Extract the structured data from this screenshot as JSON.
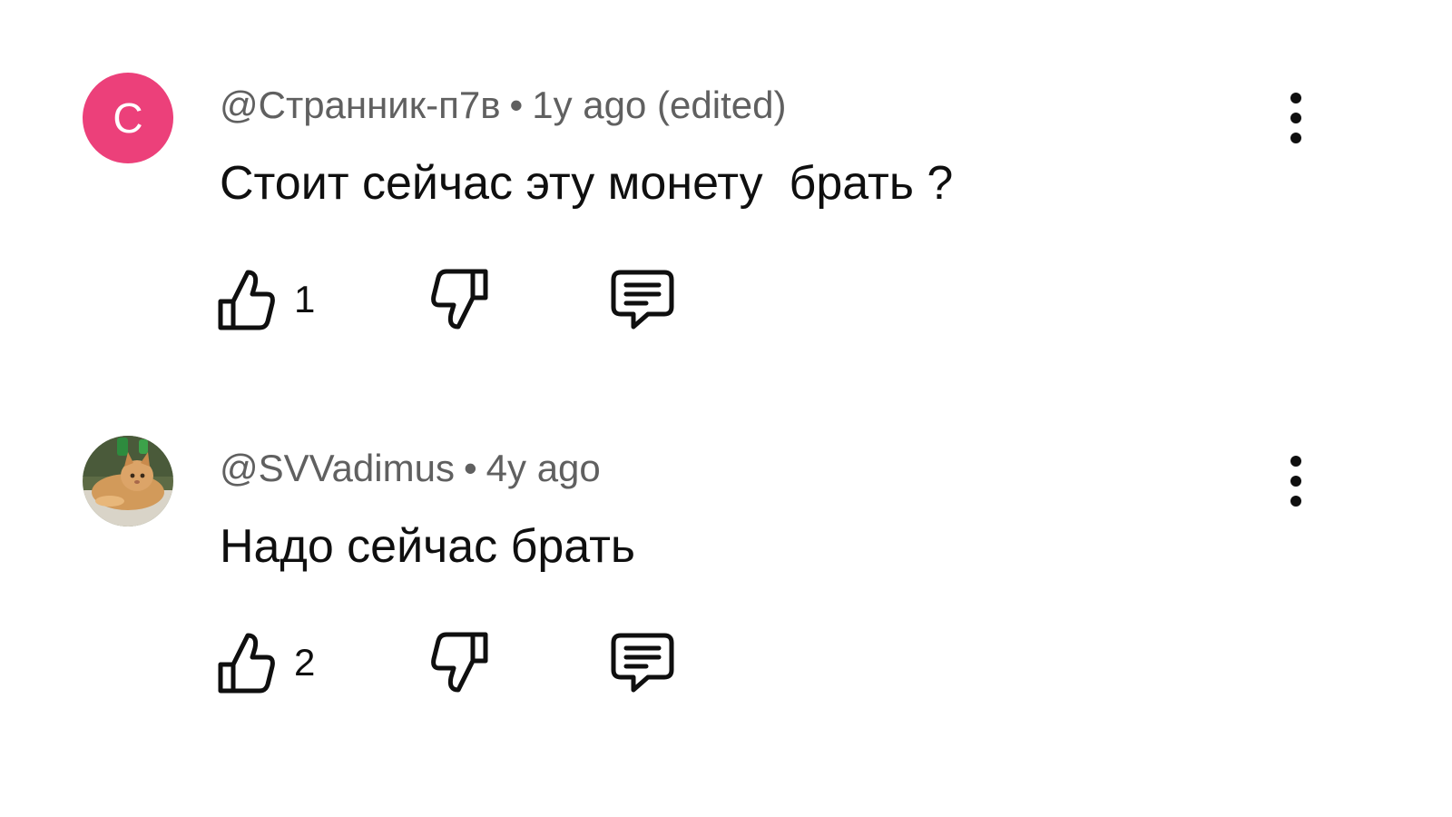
{
  "comments": [
    {
      "avatar_letter": "С",
      "avatar_color": "#ec407a",
      "author": "@Странник-п7в",
      "separator": "•",
      "time": "1y ago (edited)",
      "text": "Стоит сейчас эту монету  брать ?",
      "likes": "1"
    },
    {
      "avatar_letter": "",
      "author": "@SVVadimus",
      "separator": "•",
      "time": "4y ago",
      "text": "Надо сейчас брать",
      "likes": "2"
    }
  ],
  "icons": {
    "like": "thumb-up-outline-icon",
    "dislike": "thumb-down-outline-icon",
    "reply": "comment-bubble-icon",
    "more": "more-vertical-icon"
  },
  "colors": {
    "meta_text": "#606060",
    "body_text": "#0f0f0f",
    "avatar_pink": "#ec407a"
  }
}
